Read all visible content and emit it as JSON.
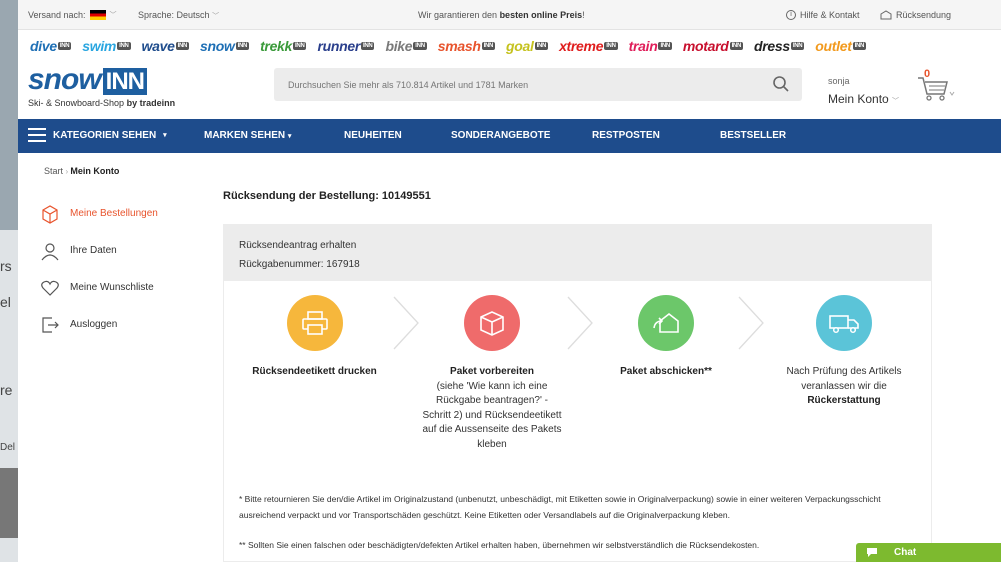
{
  "topbar": {
    "shipping_label": "Versand nach:",
    "language_label": "Sprache: Deutsch",
    "promo_prefix": "Wir garantieren den",
    "promo_bold": "besten online Preis",
    "promo_suffix": "!",
    "help": "Hilfe & Kontakt",
    "returns": "Rücksendung"
  },
  "brands": [
    {
      "name": "dive",
      "color": "#1e6fb5"
    },
    {
      "name": "swim",
      "color": "#2aa6e0"
    },
    {
      "name": "wave",
      "color": "#1e4c8c"
    },
    {
      "name": "snow",
      "color": "#1e6fb5"
    },
    {
      "name": "trekk",
      "color": "#3a9a3a"
    },
    {
      "name": "runner",
      "color": "#2a3f8c"
    },
    {
      "name": "bike",
      "color": "#7a7a7a"
    },
    {
      "name": "smash",
      "color": "#e8542d"
    },
    {
      "name": "goal",
      "color": "#c5c21e"
    },
    {
      "name": "xtreme",
      "color": "#e01e1e"
    },
    {
      "name": "train",
      "color": "#e01e5a"
    },
    {
      "name": "motard",
      "color": "#c8102e"
    },
    {
      "name": "dress",
      "color": "#222222"
    },
    {
      "name": "outlet",
      "color": "#f29a1e"
    }
  ],
  "brand_tag": "INN",
  "logo": {
    "main": "snow",
    "box": "INN",
    "sub_prefix": "Ski- & Snowboard-Shop",
    "sub_bold": "by tradeinn"
  },
  "search": {
    "placeholder": "Durchsuchen Sie mehr als 710.814 Artikel und 1781 Marken"
  },
  "account": {
    "user": "sonja",
    "label": "Mein Konto"
  },
  "cart": {
    "count": "0"
  },
  "nav": {
    "categories": "KATEGORIEN SEHEN",
    "brands": "MARKEN SEHEN",
    "new": "NEUHEITEN",
    "offers": "SONDERANGEBOTE",
    "clearance": "RESTPOSTEN",
    "bestseller": "BESTSELLER"
  },
  "breadcrumb": {
    "start": "Start",
    "current": "Mein Konto"
  },
  "sidebar": [
    {
      "label": "Meine Bestellungen"
    },
    {
      "label": "Ihre Daten"
    },
    {
      "label": "Meine Wunschliste"
    },
    {
      "label": "Ausloggen"
    }
  ],
  "main": {
    "title": "Rücksendung der Bestellung: 10149551",
    "status_line1": "Rücksendeantrag erhalten",
    "status_line2": "Rückgabenummer: 167918",
    "step1_title": "Rücksendeetikett drucken",
    "step2_title": "Paket vorbereiten",
    "step2_text": "(siehe 'Wie kann ich eine Rückgabe beantragen?' - Schritt 2) und Rücksendeetikett auf die Aussenseite des Pakets kleben",
    "step3_title": "Paket abschicken**",
    "step4_text": "Nach Prüfung des Artikels veranlassen wir die",
    "step4_bold": "Rückerstattung",
    "note1": "* Bitte retournieren Sie den/die Artikel im Originalzustand (unbenutzt, unbeschädigt, mit Etiketten sowie in Originalverpackung) sowie in einer weiteren Verpackungsschicht ausreichend verpackt und vor Transportschäden geschützt. Keine Etiketten oder Versandlabels auf die Originalverpackung kleben.",
    "note2": "** Sollten Sie einen falschen oder beschädigten/defekten Artikel erhalten haben, übernehmen wir selbstverständlich die Rücksendekosten."
  },
  "colors": {
    "step1": "#f6b73c",
    "step2": "#ef6b6b",
    "step3": "#6cc76a",
    "step4": "#5bc4d8",
    "nav": "#1e4c8c",
    "accent": "#e8542d"
  },
  "chat": {
    "label": "Chat"
  },
  "background_window": {
    "fragments": [
      "rs",
      "el",
      "re",
      "Del"
    ]
  }
}
